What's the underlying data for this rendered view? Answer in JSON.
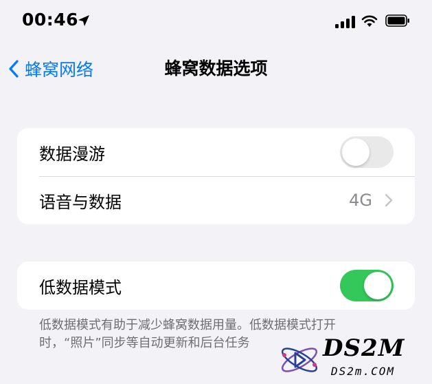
{
  "status_bar": {
    "time": "00:46"
  },
  "nav": {
    "back_label": "蜂窝网络",
    "title": "蜂窝数据选项"
  },
  "group1": {
    "roaming": {
      "label": "数据漫游",
      "toggle_on": false
    },
    "voice_data": {
      "label": "语音与数据",
      "value": "4G"
    }
  },
  "group2": {
    "low_data": {
      "label": "低数据模式",
      "toggle_on": true
    }
  },
  "footnote": {
    "line1": "低数据模式有助于减少蜂窝数据用量。低数据模式打开",
    "line2": "时，“照片”同步等自动更新和后台任务"
  },
  "watermark": {
    "title": "DS2M",
    "subtitle": "DS2m.COM"
  },
  "colors": {
    "accent": "#007aff",
    "toggle_on": "#34c759",
    "toggle_off": "#e9e9ea"
  }
}
